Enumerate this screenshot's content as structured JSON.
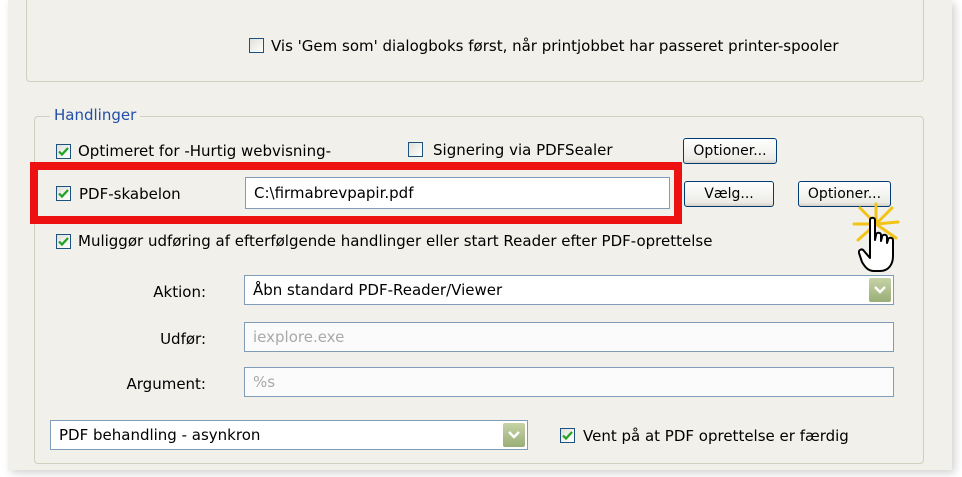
{
  "top_option": {
    "label": "Vis 'Gem som' dialogboks først, når printjobbet har passeret printer-spooler",
    "checked": false
  },
  "handlinger": {
    "legend": "Handlinger",
    "optimeret": {
      "label": "Optimeret for -Hurtig webvisning-",
      "checked": true
    },
    "signering": {
      "label": "Signering via PDFSealer",
      "checked": false
    },
    "optioner_1": "Optioner...",
    "pdf_skabelon": {
      "label": "PDF-skabelon",
      "checked": true,
      "value": "C:\\firmabrevpapir.pdf",
      "choose_button": "Vælg...",
      "optioner_button": "Optioner..."
    },
    "mulig": {
      "label": "Muliggør udføring af efterfølgende handlinger eller start Reader efter PDF-oprettelse",
      "checked": true
    },
    "aktion": {
      "label": "Aktion:",
      "value": "Åbn standard PDF-Reader/Viewer"
    },
    "udfor": {
      "label": "Udfør:",
      "value": "iexplore.exe"
    },
    "argument": {
      "label": "Argument:",
      "value": "%s"
    },
    "behandling": {
      "value": "PDF behandling - asynkron"
    },
    "vent": {
      "label": "Vent på at PDF oprettelse er færdig",
      "checked": true
    }
  },
  "colors": {
    "highlight_border": "#ee1111",
    "panel_bg": "#f1f0ea",
    "legend_text": "#1f4fa8",
    "check_green": "#21a121"
  },
  "icons": {
    "cursor": "hand-pointer-icon",
    "click_burst": "click-burst-icon"
  }
}
